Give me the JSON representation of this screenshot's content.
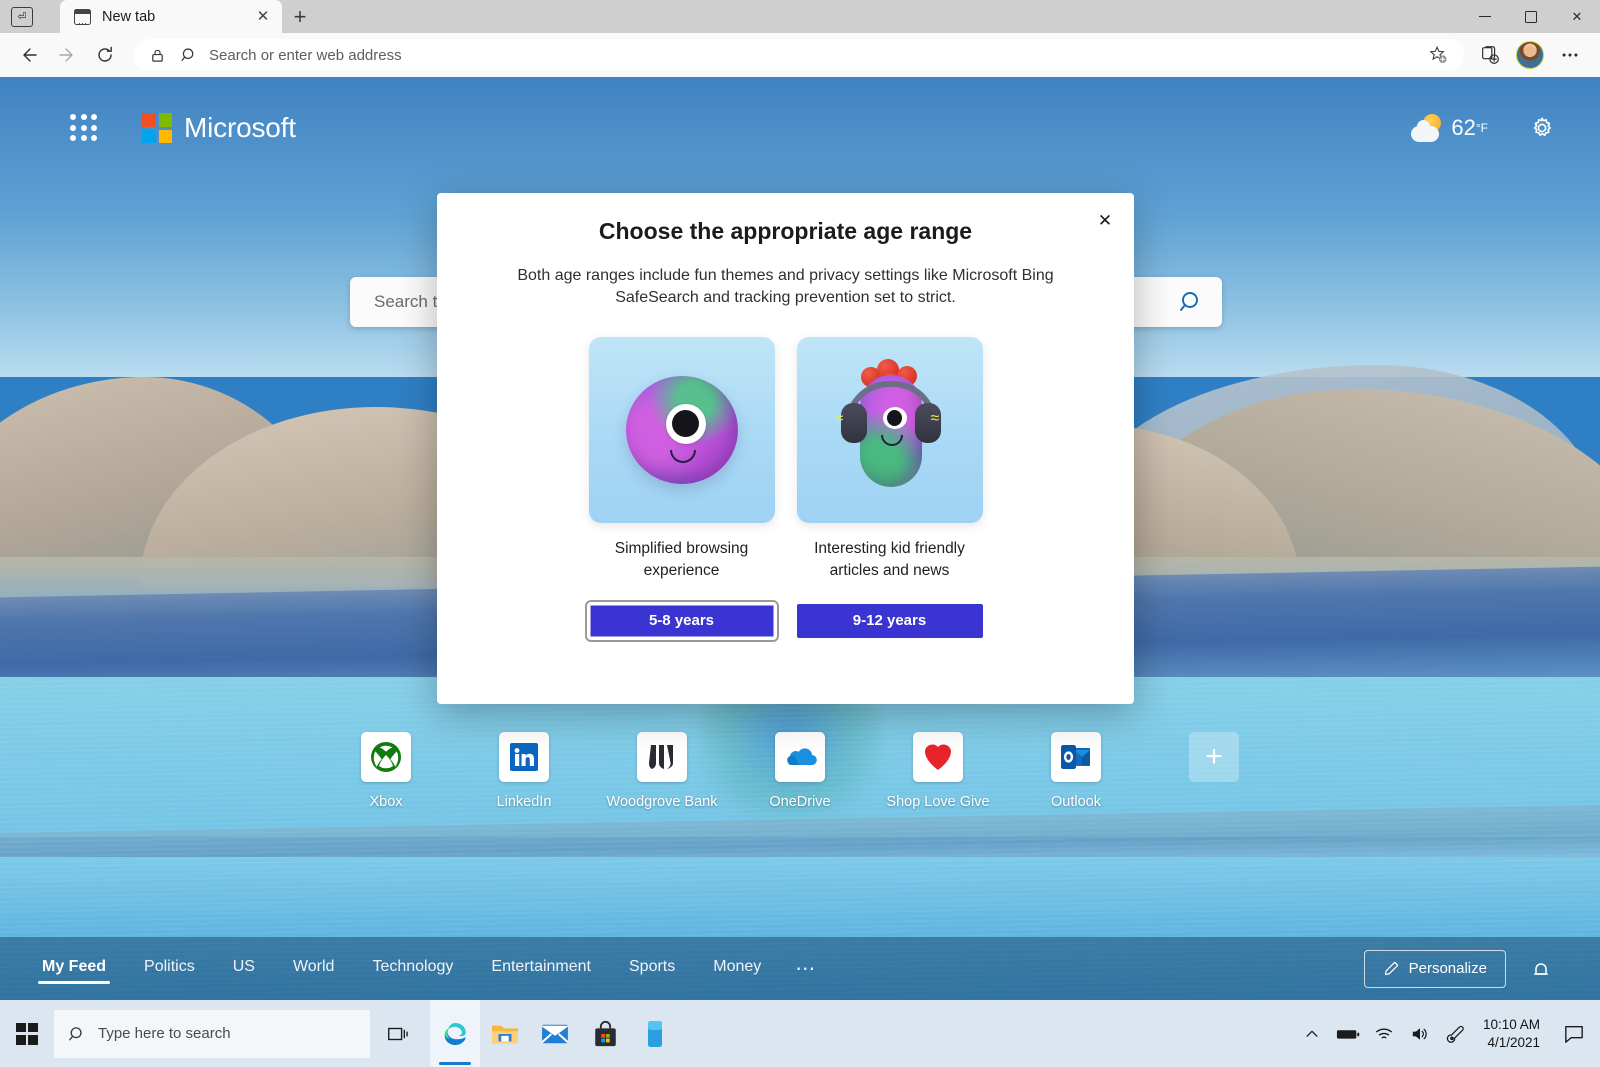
{
  "browser": {
    "tab_search_icon": "tab-search-icon",
    "tab": {
      "title": "New tab",
      "favicon": "new-tab-favicon",
      "close_icon": "close-icon"
    },
    "new_tab_label": "+",
    "window": {
      "minimize": "minimize-icon",
      "maximize": "maximize-icon",
      "close": "close-icon"
    },
    "toolbar": {
      "back_icon": "back-arrow-icon",
      "forward_icon": "forward-arrow-icon",
      "refresh_icon": "refresh-icon",
      "site_icon": "lock-icon",
      "search_icon": "search-icon",
      "address_placeholder": "Search or enter web address",
      "address_value": "",
      "favorite_icon": "star-add-icon",
      "collections_icon": "collections-icon",
      "profile_icon": "profile-avatar",
      "settings_icon": "ellipsis-icon"
    }
  },
  "newtab": {
    "waffle_icon": "app-launcher-icon",
    "brand": "Microsoft",
    "weather": {
      "icon": "partly-cloudy-icon",
      "temperature": "62",
      "unit": "°F"
    },
    "settings_icon": "gear-icon",
    "search": {
      "placeholder": "Search the web",
      "value": "",
      "button_icon": "search-icon"
    },
    "shortcuts": [
      {
        "label": "Xbox",
        "icon": "xbox-icon"
      },
      {
        "label": "LinkedIn",
        "icon": "linkedin-icon"
      },
      {
        "label": "Woodgrove Bank",
        "icon": "woodgrove-bank-icon"
      },
      {
        "label": "OneDrive",
        "icon": "onedrive-icon"
      },
      {
        "label": "Shop Love Give",
        "icon": "heart-icon"
      },
      {
        "label": "Outlook",
        "icon": "outlook-icon"
      }
    ],
    "add_shortcut": {
      "label": "+",
      "icon": "plus-icon"
    },
    "news_nav": [
      {
        "label": "My Feed",
        "active": true
      },
      {
        "label": "Politics",
        "active": false
      },
      {
        "label": "US",
        "active": false
      },
      {
        "label": "World",
        "active": false
      },
      {
        "label": "Technology",
        "active": false
      },
      {
        "label": "Entertainment",
        "active": false
      },
      {
        "label": "Sports",
        "active": false
      },
      {
        "label": "Money",
        "active": false
      }
    ],
    "news_more": "⋯",
    "personalize": {
      "label": "Personalize",
      "icon": "pencil-icon"
    },
    "notifications_icon": "bell-icon"
  },
  "dialog": {
    "title": "Choose the appropriate age range",
    "subtitle": "Both age ranges include fun themes and privacy settings like Microsoft Bing SafeSearch and tracking prevention set to strict.",
    "close_icon": "close-icon",
    "options": [
      {
        "caption": "Simplified browsing experience",
        "button": "5-8 years",
        "art": "one-eyed-blob-character",
        "focused": true
      },
      {
        "caption": "Interesting kid friendly articles and news",
        "button": "9-12 years",
        "art": "headphones-capsule-character",
        "focused": false
      }
    ],
    "accent_color": "#3a34d2"
  },
  "taskbar": {
    "start_icon": "windows-start-icon",
    "search": {
      "icon": "search-icon",
      "placeholder": "Type here to search"
    },
    "task_view_icon": "task-view-icon",
    "apps": [
      {
        "name": "Microsoft Edge",
        "icon": "edge-icon",
        "active": true
      },
      {
        "name": "File Explorer",
        "icon": "file-explorer-icon",
        "active": false
      },
      {
        "name": "Mail",
        "icon": "mail-icon",
        "active": false
      },
      {
        "name": "Microsoft Store",
        "icon": "microsoft-store-icon",
        "active": false
      },
      {
        "name": "Your Phone",
        "icon": "your-phone-icon",
        "active": false
      }
    ],
    "tray": {
      "overflow_icon": "chevron-up-icon",
      "battery_icon": "battery-icon",
      "network_icon": "wifi-icon",
      "volume_icon": "volume-icon",
      "pen_icon": "pen-icon",
      "time": "10:10 AM",
      "date": "4/1/2021",
      "action_center_icon": "action-center-icon"
    }
  }
}
